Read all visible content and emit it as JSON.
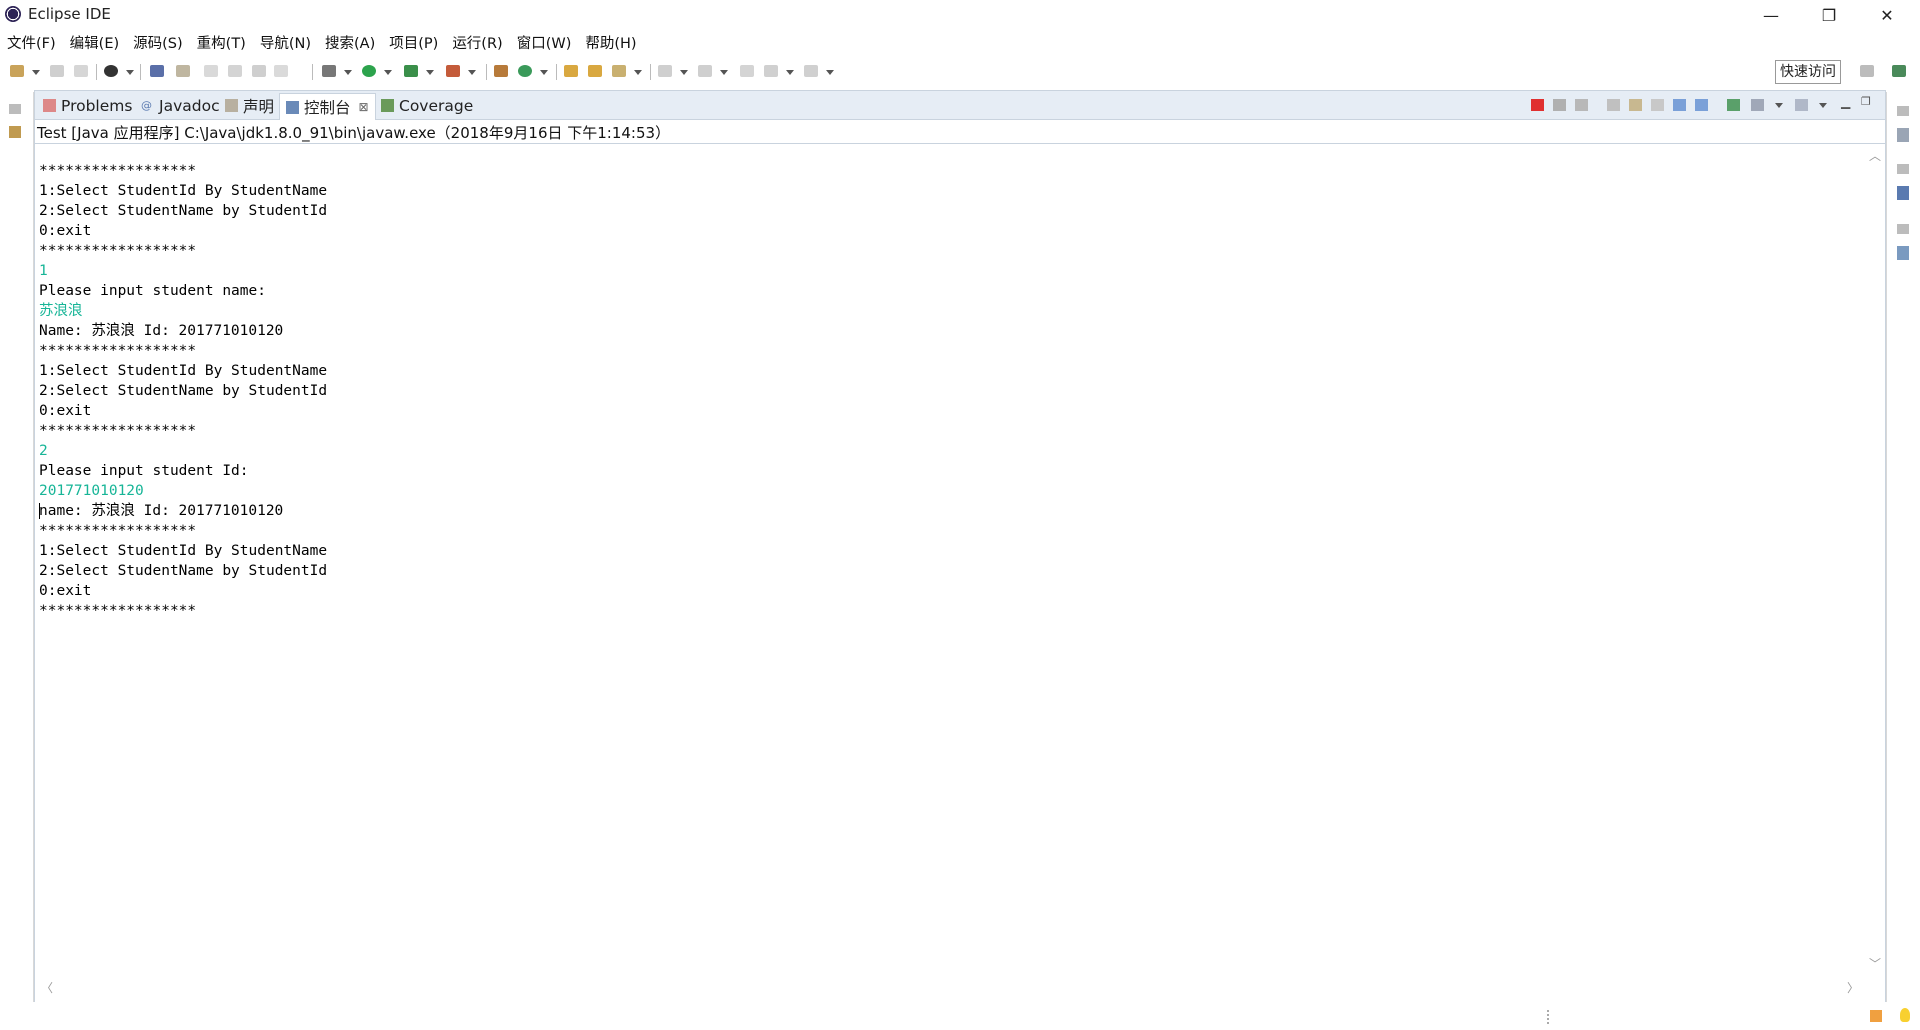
{
  "window": {
    "title": "Eclipse IDE",
    "minimize": "—",
    "restore": "❐",
    "close": "✕"
  },
  "menu": [
    "文件(F)",
    "编辑(E)",
    "源码(S)",
    "重构(T)",
    "导航(N)",
    "搜索(A)",
    "项目(P)",
    "运行(R)",
    "窗口(W)",
    "帮助(H)"
  ],
  "toolbar": {
    "quick_access": "快速访问"
  },
  "view": {
    "tabs": [
      {
        "label": "Problems",
        "icon": "problems-icon"
      },
      {
        "label": "Javadoc",
        "icon": "javadoc-icon"
      },
      {
        "label": "声明",
        "icon": "declaration-icon"
      },
      {
        "label": "控制台",
        "icon": "console-icon",
        "active": true,
        "close": "⊠"
      },
      {
        "label": "Coverage",
        "icon": "coverage-icon"
      }
    ],
    "process_line": "Test [Java 应用程序] C:\\Java\\jdk1.8.0_91\\bin\\javaw.exe（2018年9月16日 下午1:14:53）"
  },
  "console": {
    "lines": [
      {
        "text": "******************",
        "input": false
      },
      {
        "text": "1:Select StudentId By StudentName",
        "input": false
      },
      {
        "text": "2:Select StudentName by StudentId",
        "input": false
      },
      {
        "text": "0:exit",
        "input": false
      },
      {
        "text": "******************",
        "input": false
      },
      {
        "text": "1",
        "input": true
      },
      {
        "text": "Please input student name:",
        "input": false
      },
      {
        "text": "苏浪浪",
        "input": true
      },
      {
        "text": "Name: 苏浪浪 Id: 201771010120",
        "input": false
      },
      {
        "text": "******************",
        "input": false
      },
      {
        "text": "1:Select StudentId By StudentName",
        "input": false
      },
      {
        "text": "2:Select StudentName by StudentId",
        "input": false
      },
      {
        "text": "0:exit",
        "input": false
      },
      {
        "text": "******************",
        "input": false
      },
      {
        "text": "2",
        "input": true
      },
      {
        "text": "Please input student Id:",
        "input": false
      },
      {
        "text": "201771010120",
        "input": true
      },
      {
        "text": "name: 苏浪浪 Id: 201771010120",
        "input": false,
        "caret": true
      },
      {
        "text": "******************",
        "input": false
      },
      {
        "text": "1:Select StudentId By StudentName",
        "input": false
      },
      {
        "text": "2:Select StudentName by StudentId",
        "input": false
      },
      {
        "text": "0:exit",
        "input": false
      },
      {
        "text": "******************",
        "input": false
      }
    ],
    "input_color": "#17b597"
  }
}
